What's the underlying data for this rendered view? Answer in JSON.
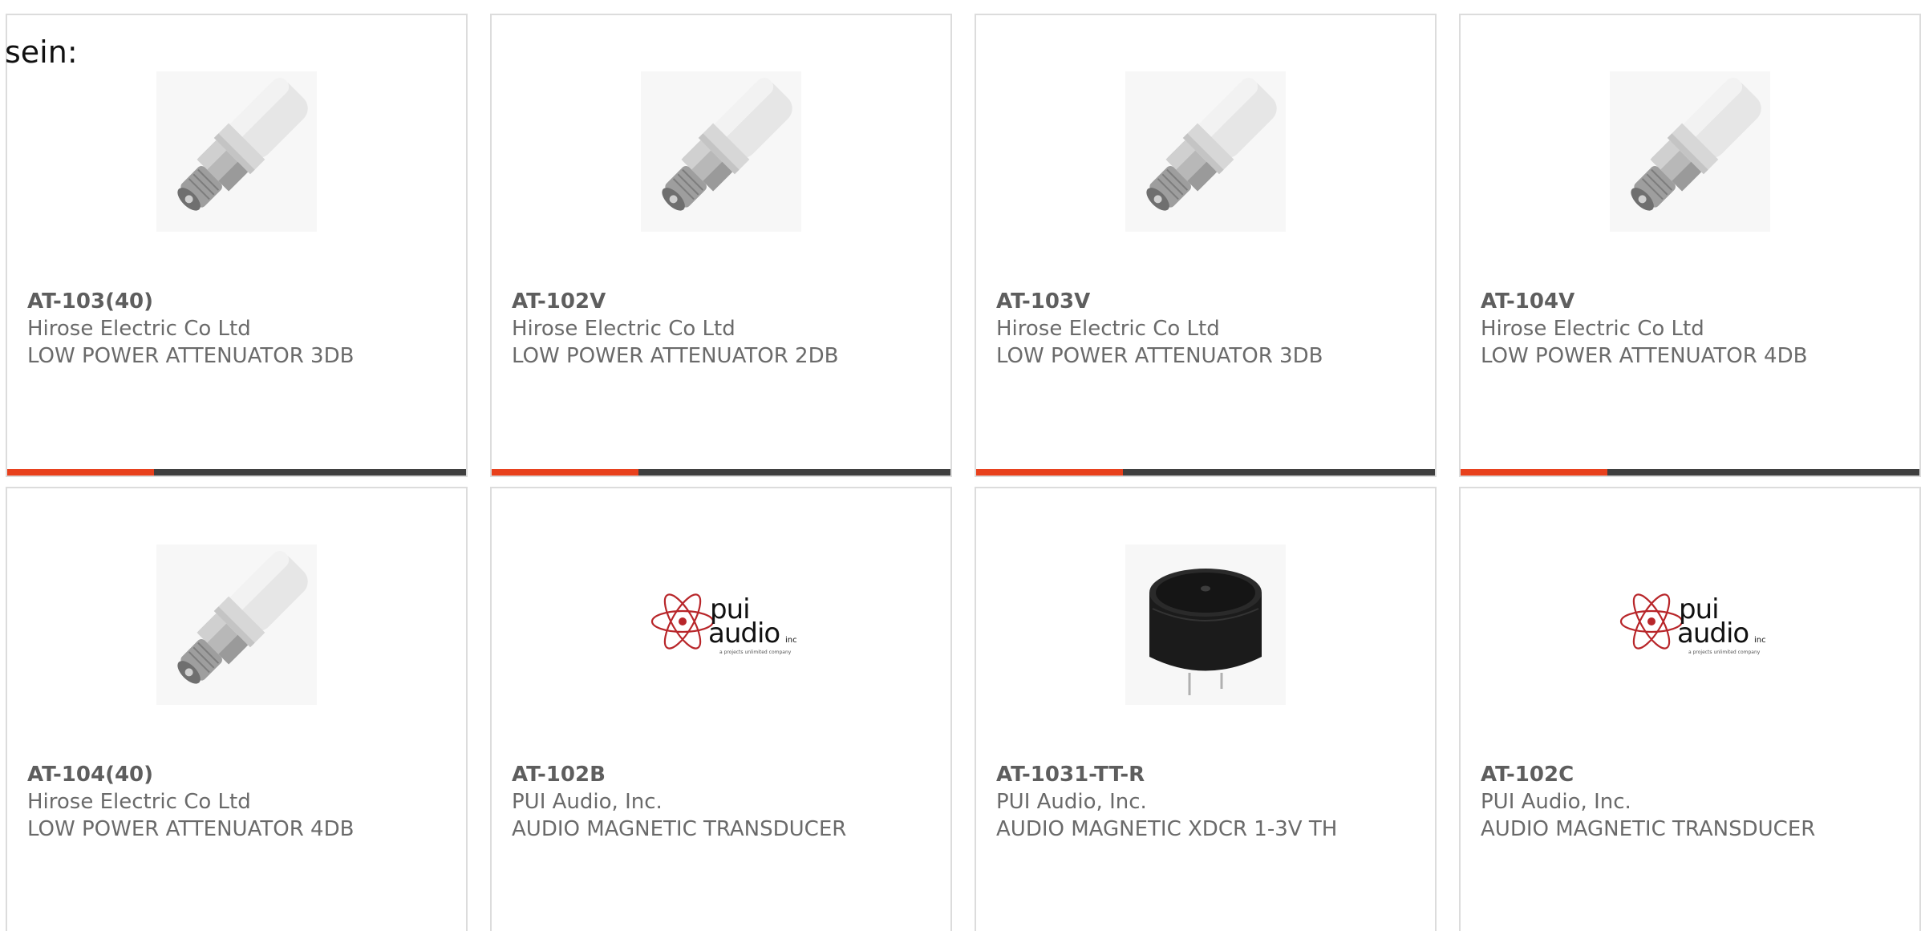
{
  "heading": "sein:",
  "theme": {
    "accent": "#e8401c",
    "bar": "#3f3f3f",
    "border": "#dcdcdc",
    "text": "#6a6a6a"
  },
  "products": [
    {
      "part": "AT-103(40)",
      "maker": "Hirose Electric Co Ltd",
      "desc": "LOW POWER ATTENUATOR 3DB",
      "image": "attenuator-image"
    },
    {
      "part": "AT-102V",
      "maker": "Hirose Electric Co Ltd",
      "desc": "LOW POWER ATTENUATOR 2DB",
      "image": "attenuator-image"
    },
    {
      "part": "AT-103V",
      "maker": "Hirose Electric Co Ltd",
      "desc": "LOW POWER ATTENUATOR 3DB",
      "image": "attenuator-image"
    },
    {
      "part": "AT-104V",
      "maker": "Hirose Electric Co Ltd",
      "desc": "LOW POWER ATTENUATOR 4DB",
      "image": "attenuator-image"
    },
    {
      "part": "AT-104(40)",
      "maker": "Hirose Electric Co Ltd",
      "desc": "LOW POWER ATTENUATOR 4DB",
      "image": "attenuator-image"
    },
    {
      "part": "AT-102B",
      "maker": "PUI Audio, Inc.",
      "desc": "AUDIO MAGNETIC TRANSDUCER",
      "image": "pui-audio-logo",
      "logo": {
        "line1": "pui",
        "line2": "audio",
        "suffix": "inc",
        "tagline": "a projects unlimited company"
      }
    },
    {
      "part": "AT-1031-TT-R",
      "maker": "PUI Audio, Inc.",
      "desc": "AUDIO MAGNETIC XDCR 1-3V TH",
      "image": "transducer-image"
    },
    {
      "part": "AT-102C",
      "maker": "PUI Audio, Inc.",
      "desc": "AUDIO MAGNETIC TRANSDUCER",
      "image": "pui-audio-logo",
      "logo": {
        "line1": "pui",
        "line2": "audio",
        "suffix": "inc",
        "tagline": "a projects unlimited company"
      }
    }
  ]
}
